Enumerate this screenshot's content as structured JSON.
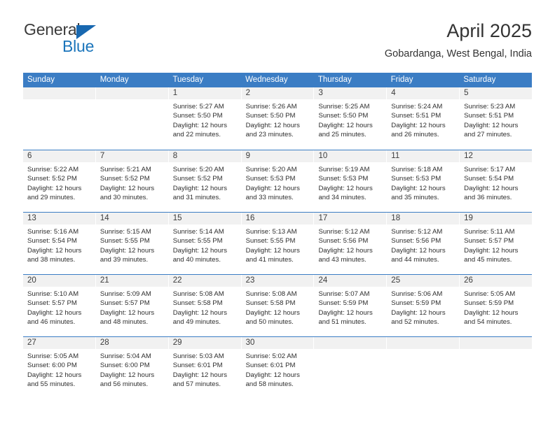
{
  "brand": {
    "word_one": "General",
    "word_two": "Blue",
    "accent_color": "#1b75bb",
    "triangle_icon": "triangle-icon"
  },
  "header": {
    "title": "April 2025",
    "subtitle": "Gobardanga, West Bengal, India"
  },
  "calendar": {
    "header_color": "#3b7dc4",
    "day_number_bg": "#f1f1f1",
    "weekdays": [
      "Sunday",
      "Monday",
      "Tuesday",
      "Wednesday",
      "Thursday",
      "Friday",
      "Saturday"
    ],
    "weeks": [
      [
        {
          "day": "",
          "sunrise": "",
          "sunset": "",
          "daylight": ""
        },
        {
          "day": "",
          "sunrise": "",
          "sunset": "",
          "daylight": ""
        },
        {
          "day": "1",
          "sunrise": "Sunrise: 5:27 AM",
          "sunset": "Sunset: 5:50 PM",
          "daylight": "Daylight: 12 hours and 22 minutes."
        },
        {
          "day": "2",
          "sunrise": "Sunrise: 5:26 AM",
          "sunset": "Sunset: 5:50 PM",
          "daylight": "Daylight: 12 hours and 23 minutes."
        },
        {
          "day": "3",
          "sunrise": "Sunrise: 5:25 AM",
          "sunset": "Sunset: 5:50 PM",
          "daylight": "Daylight: 12 hours and 25 minutes."
        },
        {
          "day": "4",
          "sunrise": "Sunrise: 5:24 AM",
          "sunset": "Sunset: 5:51 PM",
          "daylight": "Daylight: 12 hours and 26 minutes."
        },
        {
          "day": "5",
          "sunrise": "Sunrise: 5:23 AM",
          "sunset": "Sunset: 5:51 PM",
          "daylight": "Daylight: 12 hours and 27 minutes."
        }
      ],
      [
        {
          "day": "6",
          "sunrise": "Sunrise: 5:22 AM",
          "sunset": "Sunset: 5:52 PM",
          "daylight": "Daylight: 12 hours and 29 minutes."
        },
        {
          "day": "7",
          "sunrise": "Sunrise: 5:21 AM",
          "sunset": "Sunset: 5:52 PM",
          "daylight": "Daylight: 12 hours and 30 minutes."
        },
        {
          "day": "8",
          "sunrise": "Sunrise: 5:20 AM",
          "sunset": "Sunset: 5:52 PM",
          "daylight": "Daylight: 12 hours and 31 minutes."
        },
        {
          "day": "9",
          "sunrise": "Sunrise: 5:20 AM",
          "sunset": "Sunset: 5:53 PM",
          "daylight": "Daylight: 12 hours and 33 minutes."
        },
        {
          "day": "10",
          "sunrise": "Sunrise: 5:19 AM",
          "sunset": "Sunset: 5:53 PM",
          "daylight": "Daylight: 12 hours and 34 minutes."
        },
        {
          "day": "11",
          "sunrise": "Sunrise: 5:18 AM",
          "sunset": "Sunset: 5:53 PM",
          "daylight": "Daylight: 12 hours and 35 minutes."
        },
        {
          "day": "12",
          "sunrise": "Sunrise: 5:17 AM",
          "sunset": "Sunset: 5:54 PM",
          "daylight": "Daylight: 12 hours and 36 minutes."
        }
      ],
      [
        {
          "day": "13",
          "sunrise": "Sunrise: 5:16 AM",
          "sunset": "Sunset: 5:54 PM",
          "daylight": "Daylight: 12 hours and 38 minutes."
        },
        {
          "day": "14",
          "sunrise": "Sunrise: 5:15 AM",
          "sunset": "Sunset: 5:55 PM",
          "daylight": "Daylight: 12 hours and 39 minutes."
        },
        {
          "day": "15",
          "sunrise": "Sunrise: 5:14 AM",
          "sunset": "Sunset: 5:55 PM",
          "daylight": "Daylight: 12 hours and 40 minutes."
        },
        {
          "day": "16",
          "sunrise": "Sunrise: 5:13 AM",
          "sunset": "Sunset: 5:55 PM",
          "daylight": "Daylight: 12 hours and 41 minutes."
        },
        {
          "day": "17",
          "sunrise": "Sunrise: 5:12 AM",
          "sunset": "Sunset: 5:56 PM",
          "daylight": "Daylight: 12 hours and 43 minutes."
        },
        {
          "day": "18",
          "sunrise": "Sunrise: 5:12 AM",
          "sunset": "Sunset: 5:56 PM",
          "daylight": "Daylight: 12 hours and 44 minutes."
        },
        {
          "day": "19",
          "sunrise": "Sunrise: 5:11 AM",
          "sunset": "Sunset: 5:57 PM",
          "daylight": "Daylight: 12 hours and 45 minutes."
        }
      ],
      [
        {
          "day": "20",
          "sunrise": "Sunrise: 5:10 AM",
          "sunset": "Sunset: 5:57 PM",
          "daylight": "Daylight: 12 hours and 46 minutes."
        },
        {
          "day": "21",
          "sunrise": "Sunrise: 5:09 AM",
          "sunset": "Sunset: 5:57 PM",
          "daylight": "Daylight: 12 hours and 48 minutes."
        },
        {
          "day": "22",
          "sunrise": "Sunrise: 5:08 AM",
          "sunset": "Sunset: 5:58 PM",
          "daylight": "Daylight: 12 hours and 49 minutes."
        },
        {
          "day": "23",
          "sunrise": "Sunrise: 5:08 AM",
          "sunset": "Sunset: 5:58 PM",
          "daylight": "Daylight: 12 hours and 50 minutes."
        },
        {
          "day": "24",
          "sunrise": "Sunrise: 5:07 AM",
          "sunset": "Sunset: 5:59 PM",
          "daylight": "Daylight: 12 hours and 51 minutes."
        },
        {
          "day": "25",
          "sunrise": "Sunrise: 5:06 AM",
          "sunset": "Sunset: 5:59 PM",
          "daylight": "Daylight: 12 hours and 52 minutes."
        },
        {
          "day": "26",
          "sunrise": "Sunrise: 5:05 AM",
          "sunset": "Sunset: 5:59 PM",
          "daylight": "Daylight: 12 hours and 54 minutes."
        }
      ],
      [
        {
          "day": "27",
          "sunrise": "Sunrise: 5:05 AM",
          "sunset": "Sunset: 6:00 PM",
          "daylight": "Daylight: 12 hours and 55 minutes."
        },
        {
          "day": "28",
          "sunrise": "Sunrise: 5:04 AM",
          "sunset": "Sunset: 6:00 PM",
          "daylight": "Daylight: 12 hours and 56 minutes."
        },
        {
          "day": "29",
          "sunrise": "Sunrise: 5:03 AM",
          "sunset": "Sunset: 6:01 PM",
          "daylight": "Daylight: 12 hours and 57 minutes."
        },
        {
          "day": "30",
          "sunrise": "Sunrise: 5:02 AM",
          "sunset": "Sunset: 6:01 PM",
          "daylight": "Daylight: 12 hours and 58 minutes."
        },
        {
          "day": "",
          "sunrise": "",
          "sunset": "",
          "daylight": ""
        },
        {
          "day": "",
          "sunrise": "",
          "sunset": "",
          "daylight": ""
        },
        {
          "day": "",
          "sunrise": "",
          "sunset": "",
          "daylight": ""
        }
      ]
    ]
  }
}
